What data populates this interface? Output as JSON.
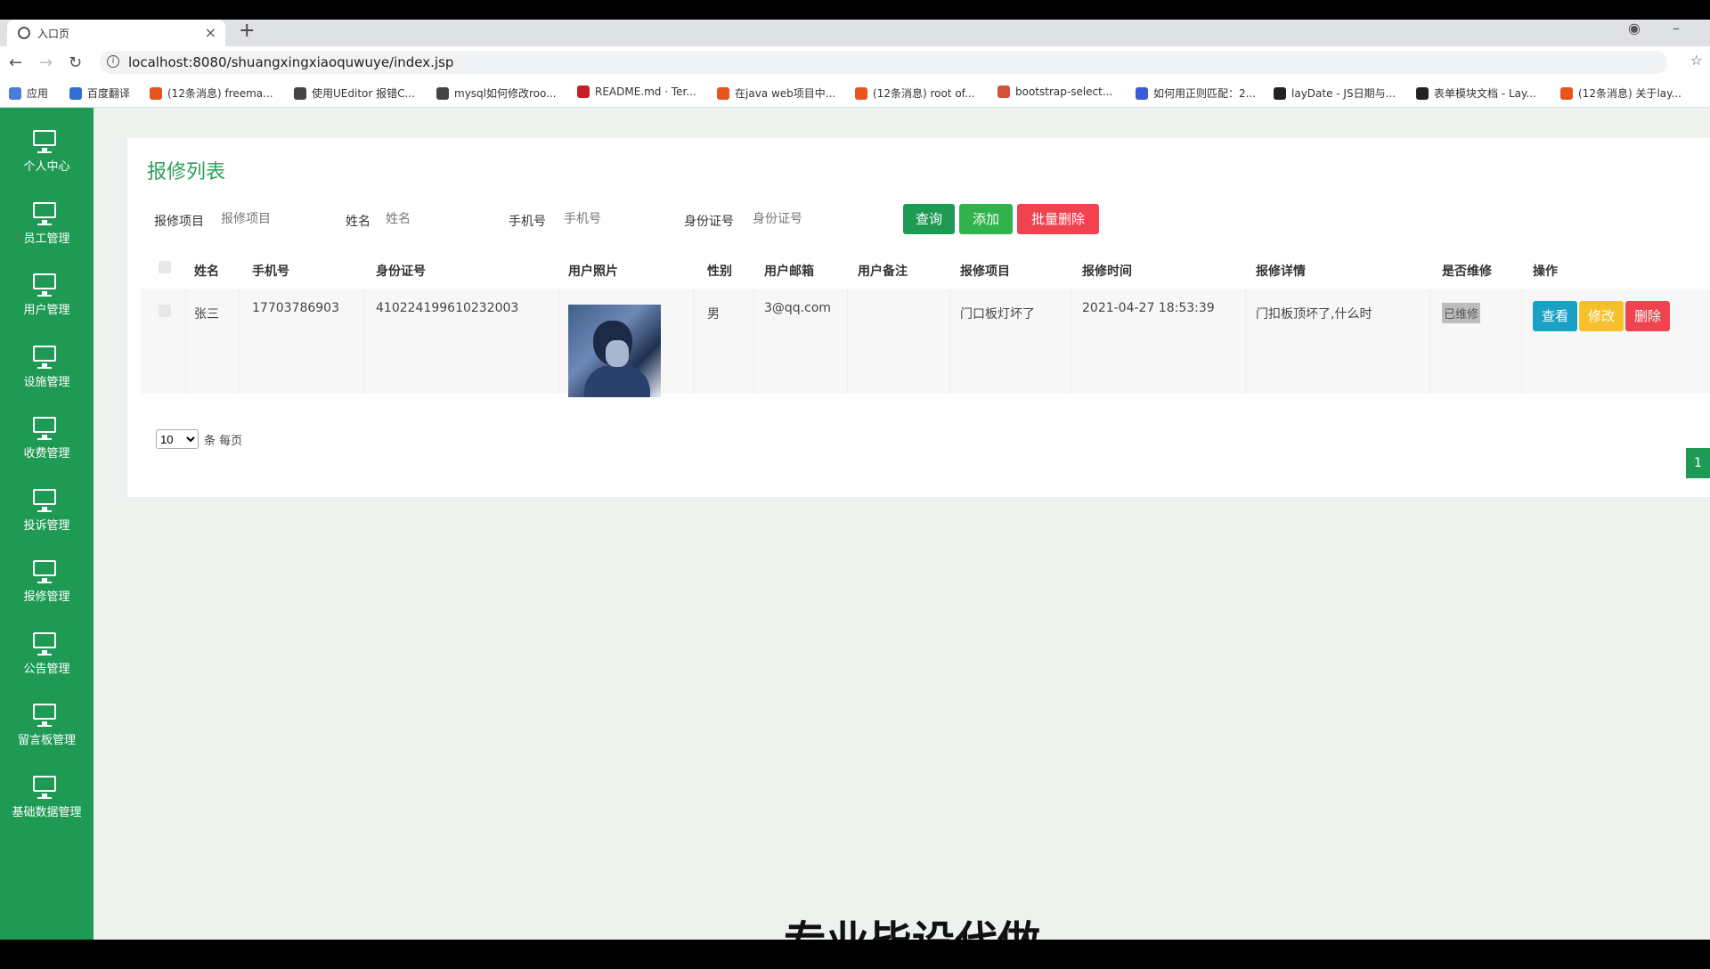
{
  "browser": {
    "tab_title": "入口页",
    "url": "localhost:8080/shuangxingxiaoquwuye/index.jsp"
  },
  "bookmarks": [
    {
      "label": "应用",
      "color": "#4a7bd8"
    },
    {
      "label": "百度翻译",
      "color": "#2f6fd6"
    },
    {
      "label": "(12条消息) freema...",
      "color": "#e8541e"
    },
    {
      "label": "使用UEditor 报错C...",
      "color": "#444444"
    },
    {
      "label": "mysql如何修改roo...",
      "color": "#444444"
    },
    {
      "label": "README.md · Ter...",
      "color": "#c71d23"
    },
    {
      "label": "在java web项目中...",
      "color": "#e8541e"
    },
    {
      "label": "(12条消息) root of...",
      "color": "#e8541e"
    },
    {
      "label": "bootstrap-select...",
      "color": "#d4503a"
    },
    {
      "label": "如何用正则匹配：2...",
      "color": "#3a5bd8"
    },
    {
      "label": "layDate - JS日期与...",
      "color": "#222222"
    },
    {
      "label": "表单模块文档 - Lay...",
      "color": "#222222"
    },
    {
      "label": "(12条消息) 关于lay...",
      "color": "#e8541e"
    }
  ],
  "sidebar": {
    "items": [
      {
        "label": "个人中心"
      },
      {
        "label": "员工管理"
      },
      {
        "label": "用户管理"
      },
      {
        "label": "设施管理"
      },
      {
        "label": "收费管理"
      },
      {
        "label": "投诉管理"
      },
      {
        "label": "报修管理"
      },
      {
        "label": "公告管理"
      },
      {
        "label": "留言板管理"
      },
      {
        "label": "基础数据管理"
      }
    ]
  },
  "page": {
    "title": "报修列表",
    "filters": {
      "project_label": "报修项目",
      "project_placeholder": "报修项目",
      "name_label": "姓名",
      "name_placeholder": "姓名",
      "phone_label": "手机号",
      "phone_placeholder": "手机号",
      "id_label": "身份证号",
      "id_placeholder": "身份证号"
    },
    "buttons": {
      "query": "查询",
      "add": "添加",
      "batch_delete": "批量删除"
    }
  },
  "table": {
    "columns": [
      "姓名",
      "手机号",
      "身份证号",
      "用户照片",
      "性别",
      "用户邮箱",
      "用户备注",
      "报修项目",
      "报修时间",
      "报修详情",
      "是否维修",
      "操作"
    ],
    "rows": [
      {
        "name": "张三",
        "phone": "17703786903",
        "id_card": "410224199610232003",
        "gender": "男",
        "email": "3@qq.com",
        "note": "",
        "project": "门口板灯坏了",
        "time": "2021-04-27 18:53:39",
        "detail": "门扣板顶坏了,什么时",
        "status": "已维修",
        "actions": {
          "view": "查看",
          "edit": "修改",
          "delete": "删除"
        }
      }
    ]
  },
  "pagination": {
    "page_size": "10",
    "page_size_suffix": "条 每页",
    "current_page": "1"
  },
  "watermark": "专业毕设代做",
  "colors": {
    "sidebar": "#1f9a55",
    "query": "#1f9a55",
    "add": "#2fb34a",
    "danger": "#f0424f",
    "view": "#19a2c5",
    "edit": "#f6c02a"
  }
}
